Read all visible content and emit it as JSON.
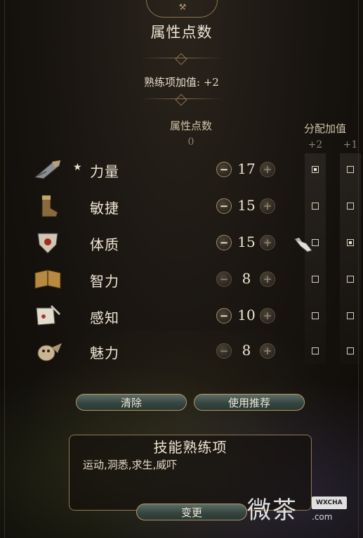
{
  "header": {
    "title": "属性点数",
    "bonus_line": "熟练项加值: +2"
  },
  "columns": {
    "points_label": "属性点数",
    "points_remaining": "0",
    "assign_label": "分配加值",
    "plus2_label": "+2",
    "plus1_label": "+1"
  },
  "attributes": [
    {
      "name": "力量",
      "value": "17",
      "starred": true,
      "icon": "gauntlet-icon",
      "plus2": true,
      "plus1": false,
      "minus_enabled": true
    },
    {
      "name": "敏捷",
      "value": "15",
      "starred": false,
      "icon": "boot-icon",
      "plus2": false,
      "plus1": false,
      "minus_enabled": true
    },
    {
      "name": "体质",
      "value": "15",
      "starred": false,
      "icon": "heart-shield-icon",
      "plus2": false,
      "plus1": true,
      "minus_enabled": true
    },
    {
      "name": "智力",
      "value": "8",
      "starred": false,
      "icon": "book-icon",
      "plus2": false,
      "plus1": false,
      "minus_enabled": false
    },
    {
      "name": "感知",
      "value": "10",
      "starred": false,
      "icon": "scroll-quill-icon",
      "plus2": false,
      "plus1": false,
      "minus_enabled": true
    },
    {
      "name": "魅力",
      "value": "8",
      "starred": false,
      "icon": "owl-icon",
      "plus2": false,
      "plus1": false,
      "minus_enabled": false
    }
  ],
  "symbols": {
    "star": "★",
    "minus": "−",
    "plus": "+"
  },
  "actions": {
    "clear_label": "清除",
    "recommend_label": "使用推荐",
    "change_label": "变更"
  },
  "skills": {
    "title": "技能熟练项",
    "list": "运动,洞悉,求生,威吓"
  },
  "watermark": {
    "text": "微茶",
    "badge": "WXCHA",
    "sub": ".com"
  },
  "colors": {
    "gold_border": "#b39869",
    "button_teal": "#364640",
    "text_light": "#efe6d4"
  }
}
